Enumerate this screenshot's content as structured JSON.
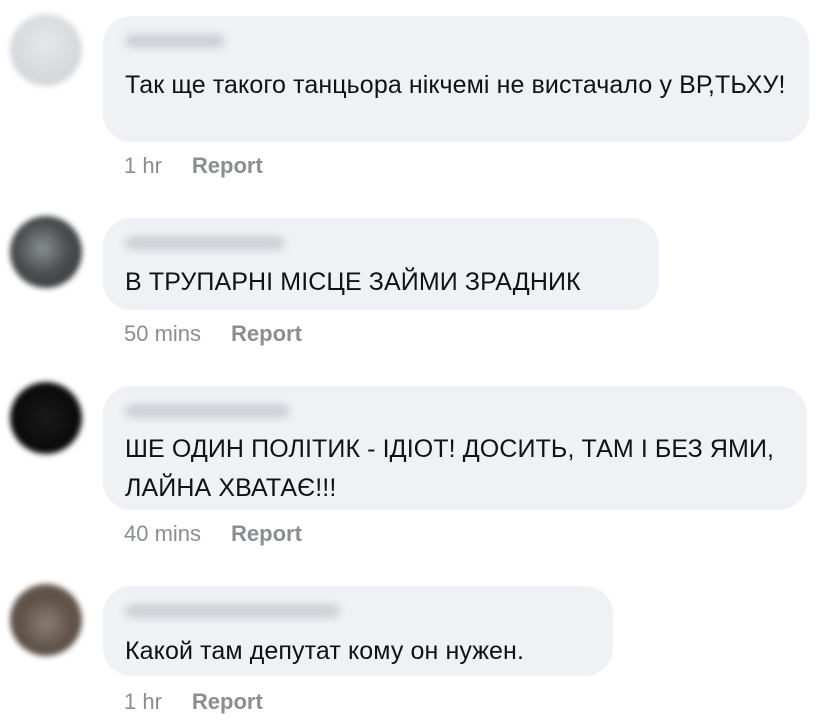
{
  "comments": [
    {
      "text": "Так ще такого танцьора нікчемі не вистачало у ВР,ТЬХУ!",
      "time": "1 hr",
      "report": "Report"
    },
    {
      "text": "В ТРУПАРНІ МІСЦЕ ЗАЙМИ ЗРАДНИК",
      "time": "50 mins",
      "report": "Report"
    },
    {
      "text": "ШЕ ОДИН ПОЛІТИК - ІДІОТ! ДОСИТЬ, ТАМ І БЕЗ ЯМИ, ЛАЙНА ХВАТАЄ!!!",
      "time": "40 mins",
      "report": "Report"
    },
    {
      "text": "Какой там депутат кому он нужен.",
      "time": "1 hr",
      "report": "Report"
    }
  ],
  "colors": {
    "bubble": "#eff1f4",
    "meta_text": "#8a8d91",
    "body_text": "#111111"
  }
}
